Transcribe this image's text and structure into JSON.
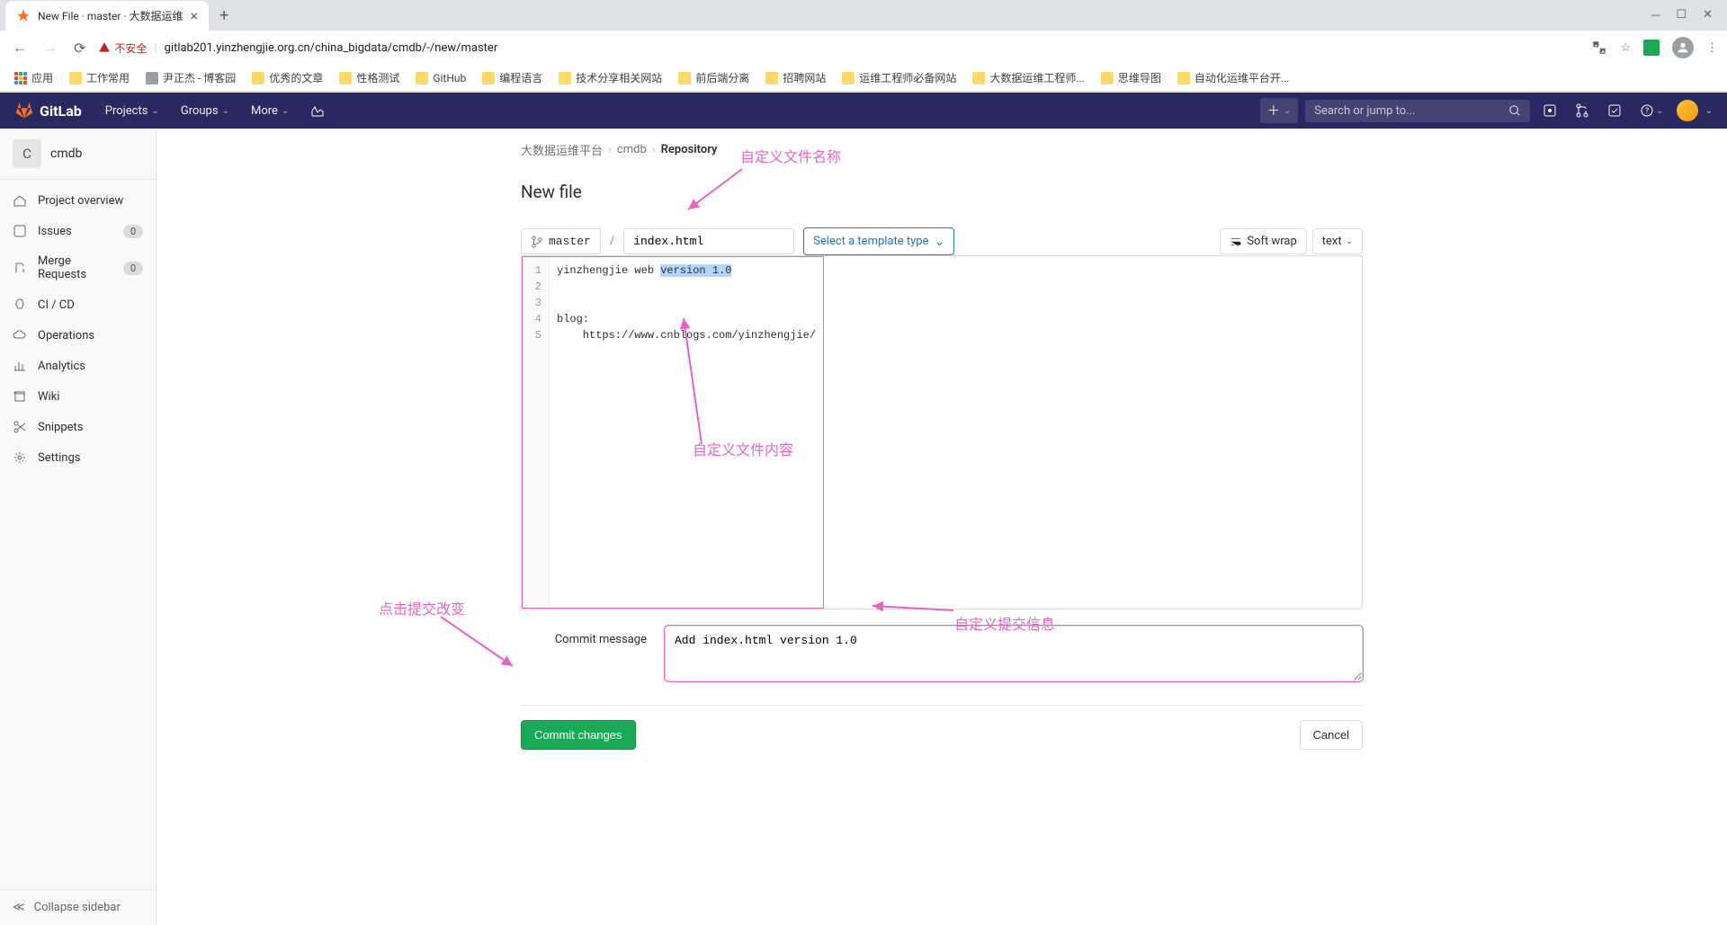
{
  "browser": {
    "tab_title": "New File · master · 大数据运维",
    "url": "gitlab201.yinzhengjie.org.cn/china_bigdata/cmdb/-/new/master",
    "insecure_label": "不安全",
    "apps_label": "应用",
    "bookmarks": [
      "工作常用",
      "尹正杰 - 博客园",
      "优秀的文章",
      "性格测试",
      "GitHub",
      "编程语言",
      "技术分享相关网站",
      "前后端分离",
      "招聘网站",
      "运维工程师必备网站",
      "大数据运维工程师...",
      "思维导图",
      "自动化运维平台开..."
    ]
  },
  "gitlab": {
    "brand": "GitLab",
    "nav": {
      "projects": "Projects",
      "groups": "Groups",
      "more": "More"
    },
    "search_placeholder": "Search or jump to..."
  },
  "sidebar": {
    "project_letter": "C",
    "project_name": "cmdb",
    "items": [
      {
        "label": "Project overview"
      },
      {
        "label": "Issues",
        "badge": "0"
      },
      {
        "label": "Merge Requests",
        "badge": "0"
      },
      {
        "label": "CI / CD"
      },
      {
        "label": "Operations"
      },
      {
        "label": "Analytics"
      },
      {
        "label": "Wiki"
      },
      {
        "label": "Snippets"
      },
      {
        "label": "Settings"
      }
    ],
    "collapse": "Collapse sidebar"
  },
  "breadcrumb": {
    "group": "大数据运维平台",
    "project": "cmdb",
    "page": "Repository"
  },
  "page": {
    "title": "New file",
    "branch": "master",
    "filename": "index.html",
    "template_placeholder": "Select a template type",
    "softwrap": "Soft wrap",
    "text_label": "text"
  },
  "editor": {
    "line_numbers": [
      "1",
      "2",
      "3",
      "4",
      "5"
    ],
    "line1_a": "yinzhengjie web ",
    "line1_b": "version 1.0",
    "line4": "blog:",
    "line5": "    https://www.cnblogs.com/yinzhengjie/"
  },
  "commit": {
    "label": "Commit message",
    "message": "Add index.html version 1.0",
    "commit_btn": "Commit changes",
    "cancel_btn": "Cancel"
  },
  "annotations": {
    "filename": "自定义文件名称",
    "content": "自定义文件内容",
    "commit_msg": "自定义提交信息",
    "commit_click": "点击提交改变"
  }
}
